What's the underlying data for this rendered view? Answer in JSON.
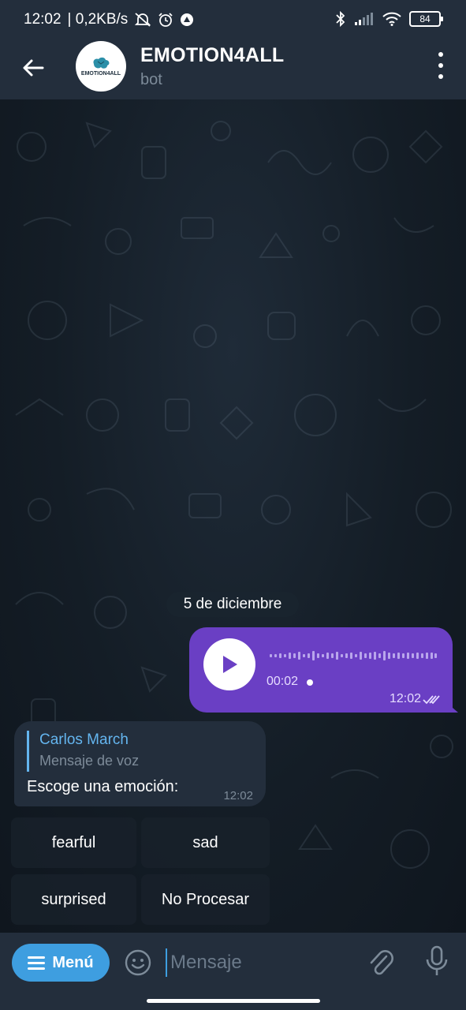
{
  "status_bar": {
    "time": "12:02",
    "net_speed": "| 0,2KB/s",
    "battery": "84"
  },
  "header": {
    "title": "EMOTION4ALL",
    "subtitle": "bot",
    "avatar_text": "EMOTION4ALL"
  },
  "date_separator": "5 de diciembre",
  "voice_message": {
    "duration": "00:02",
    "time": "12:02"
  },
  "bot_message": {
    "reply_name": "Carlos March",
    "reply_text": "Mensaje de voz",
    "text": "Escoge una emoción:",
    "time": "12:02"
  },
  "keyboard": {
    "buttons": [
      "fearful",
      "sad",
      "surprised",
      "No Procesar"
    ]
  },
  "input_bar": {
    "menu_label": "Menú",
    "placeholder": "Mensaje"
  },
  "colors": {
    "outgoing_bubble": "#6a3fc4",
    "accent": "#3e9ee0",
    "reply_accent": "#64b5ef"
  }
}
